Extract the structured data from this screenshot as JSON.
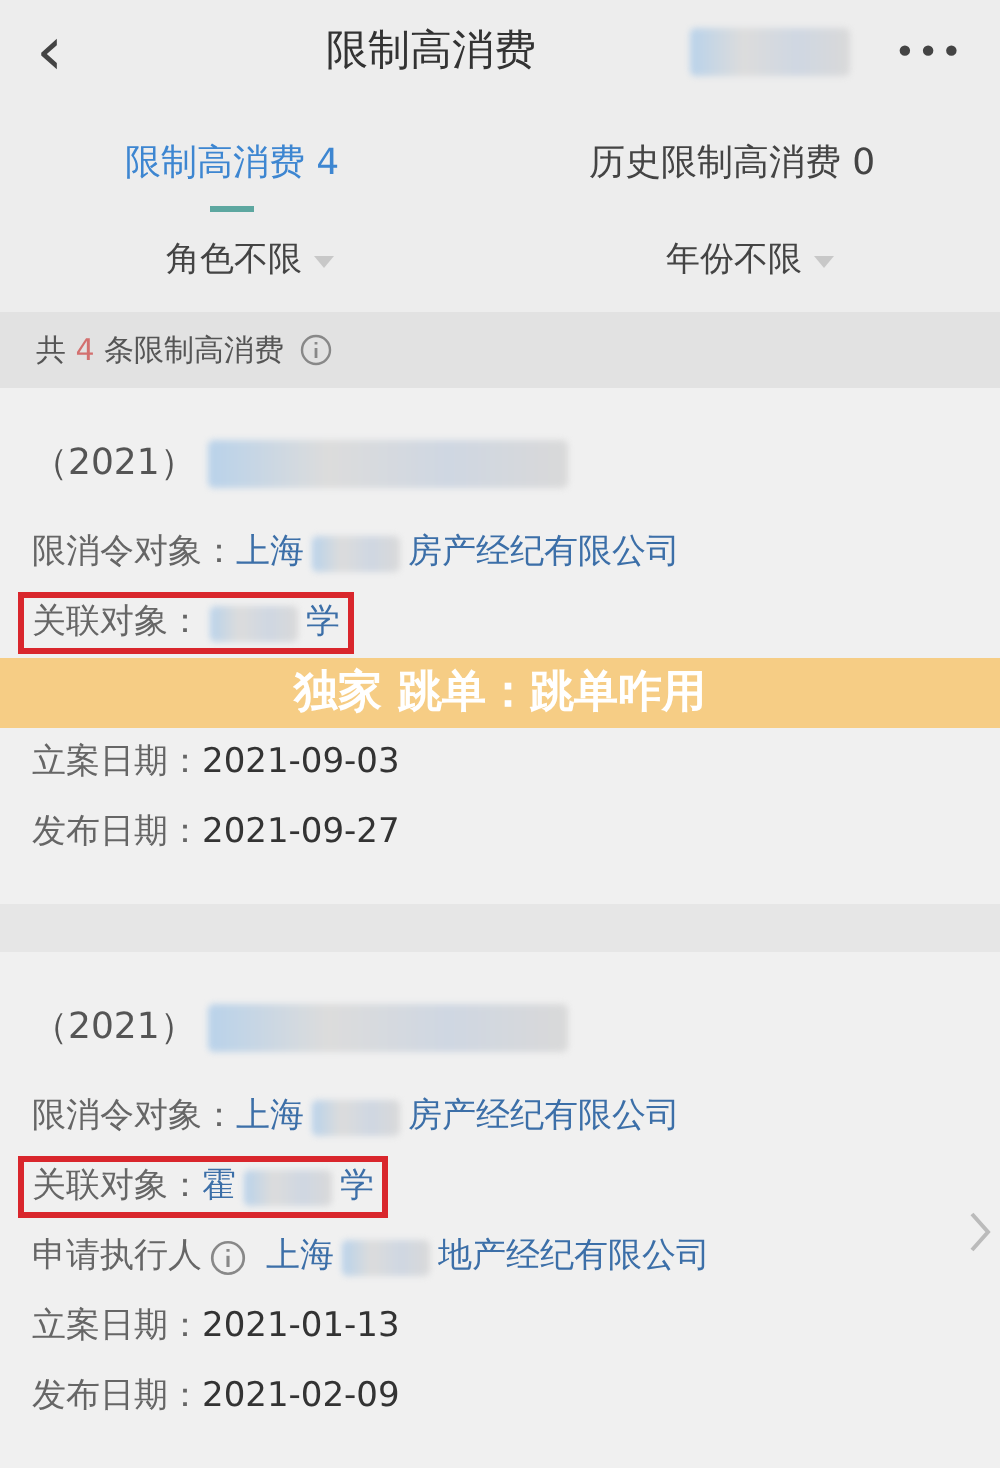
{
  "header": {
    "title": "限制高消费",
    "back": "‹",
    "more": "•••"
  },
  "tabs": [
    {
      "label": "限制高消费 4",
      "selected": true
    },
    {
      "label": "历史限制高消费 0",
      "selected": false
    }
  ],
  "filters": [
    {
      "label": "角色不限"
    },
    {
      "label": "年份不限"
    }
  ],
  "summary": {
    "prefix": "共",
    "count": "4",
    "suffix": "条限制高消费"
  },
  "cards": [
    {
      "case_number": "（2021）",
      "rows": [
        {
          "label": "限消令对象：",
          "highlighted": false,
          "parts": [
            {
              "kind": "text",
              "text": "上海"
            },
            {
              "kind": "redacted"
            },
            {
              "kind": "text",
              "text": "房产经纪有限公司"
            }
          ],
          "link": true
        },
        {
          "label": "关联对象：",
          "highlighted": true,
          "parts": [
            {
              "kind": "redacted"
            },
            {
              "kind": "text",
              "text": "学"
            }
          ],
          "link": true
        },
        {
          "label": "立案日期：",
          "highlighted": false,
          "parts": [
            {
              "kind": "text",
              "text": "2021-09-03"
            }
          ],
          "link": false
        },
        {
          "label": "发布日期：",
          "highlighted": false,
          "parts": [
            {
              "kind": "text",
              "text": "2021-09-27"
            }
          ],
          "link": false
        }
      ],
      "chevron": false,
      "banner": "独家 跳单：跳单咋用"
    },
    {
      "case_number": "（2021）",
      "rows": [
        {
          "label": "限消令对象：",
          "highlighted": false,
          "parts": [
            {
              "kind": "text",
              "text": "上海"
            },
            {
              "kind": "redacted"
            },
            {
              "kind": "text",
              "text": "房产经纪有限公司"
            }
          ],
          "link": true
        },
        {
          "label": "关联对象：",
          "highlighted": true,
          "parts": [
            {
              "kind": "text",
              "text": "霍"
            },
            {
              "kind": "redacted"
            },
            {
              "kind": "text",
              "text": "学"
            }
          ],
          "link": true
        },
        {
          "label": "申请执行人",
          "info": true,
          "highlighted": false,
          "parts": [
            {
              "kind": "text",
              "text": "上海"
            },
            {
              "kind": "redacted"
            },
            {
              "kind": "text",
              "text": "地产经纪有限公司"
            }
          ],
          "link": true
        },
        {
          "label": "立案日期：",
          "highlighted": false,
          "parts": [
            {
              "kind": "text",
              "text": "2021-01-13"
            }
          ],
          "link": false
        },
        {
          "label": "发布日期：",
          "highlighted": false,
          "parts": [
            {
              "kind": "text",
              "text": "2021-02-09"
            }
          ],
          "link": false
        }
      ],
      "chevron": true
    }
  ]
}
